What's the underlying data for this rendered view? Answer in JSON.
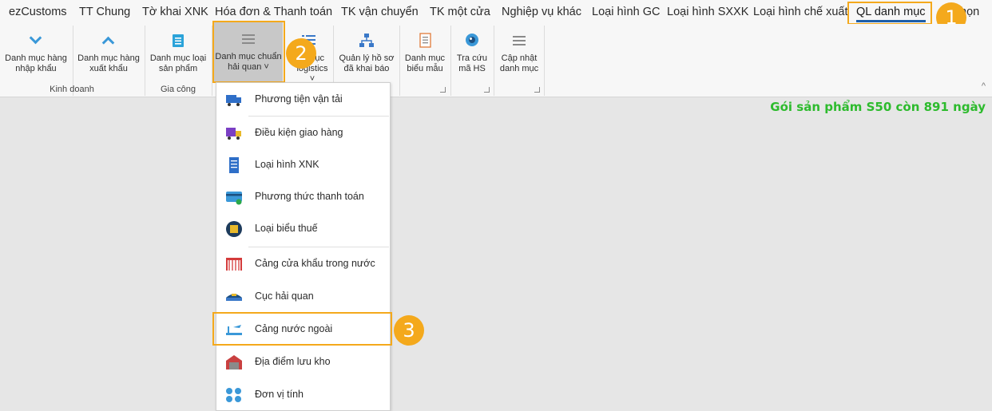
{
  "menu": {
    "items": [
      {
        "label": "ezCustoms"
      },
      {
        "label": "TT Chung"
      },
      {
        "label": "Tờ khai XNK"
      },
      {
        "label": "Hóa đơn & Thanh toán"
      },
      {
        "label": "TK vận chuyển"
      },
      {
        "label": "TK một cửa"
      },
      {
        "label": "Nghiệp vụ khác"
      },
      {
        "label": "Loại hình GC"
      },
      {
        "label": "Loại hình SXXK"
      },
      {
        "label": "Loại hình chế xuất"
      },
      {
        "label": "QL danh mục"
      },
      {
        "label": "Tùy chọn"
      }
    ],
    "partial_last": "họn"
  },
  "ribbon": {
    "buttons": [
      {
        "label": "Danh mục hàng\nnhập khẩu",
        "icon": "chevron-down-icon"
      },
      {
        "label": "Danh mục hàng\nxuất khẩu",
        "icon": "chevron-up-icon"
      },
      {
        "label": "Danh mục loại\nsản phẩm",
        "icon": "list-icon"
      },
      {
        "label": "Danh mục chuẩn\nhải quan ˅",
        "icon": "list-lines-icon"
      },
      {
        "label": "...mục\nlogistics ˅",
        "icon": "list-lines-blue-icon"
      },
      {
        "label": "Quản lý hồ sơ\nđã khai báo",
        "icon": "network-icon"
      },
      {
        "label": "Danh mục\nbiểu mẫu",
        "icon": "form-icon"
      },
      {
        "label": "Tra cứu\nmã HS",
        "icon": "eye-icon"
      },
      {
        "label": "Cập nhật\ndanh mục",
        "icon": "list-lines-icon"
      }
    ],
    "groups": [
      {
        "label": "Kinh doanh"
      },
      {
        "label": "Gia công"
      }
    ],
    "collapse": "^"
  },
  "status": {
    "text": "Gói sản phẩm S50 còn 891 ngày",
    "color": "#2dbb2d"
  },
  "badges": [
    "1",
    "2",
    "3"
  ],
  "dropdown": {
    "items": [
      {
        "label": "Phương tiện vận tải",
        "icon": "truck-icon"
      },
      {
        "label": "Điều kiện giao hàng",
        "icon": "delivery-truck-icon"
      },
      {
        "label": "Loại hình XNK",
        "icon": "document-icon"
      },
      {
        "label": "Phương thức thanh toán",
        "icon": "credit-card-icon"
      },
      {
        "label": "Loại biểu thuế",
        "icon": "tax-chip-icon"
      },
      {
        "label": "Cảng cửa khẩu trong nước",
        "icon": "gate-icon"
      },
      {
        "label": "Cục hải quan",
        "icon": "customs-cap-icon"
      },
      {
        "label": "Cảng nước ngoài",
        "icon": "airport-icon"
      },
      {
        "label": "Địa điểm lưu kho",
        "icon": "warehouse-icon"
      },
      {
        "label": "Đơn vị tính",
        "icon": "units-icon"
      }
    ]
  },
  "colors": {
    "accent": "#f4a91c",
    "brand_blue": "#1e5ea8",
    "icon_blue": "#3a98d8",
    "status_green": "#2dbb2d"
  }
}
